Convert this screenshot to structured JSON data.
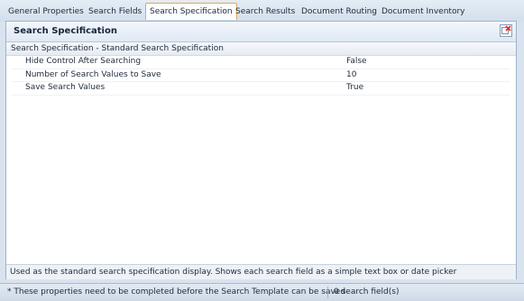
{
  "tabs": [
    {
      "label": "General Properties"
    },
    {
      "label": "Search Fields"
    },
    {
      "label": "Search Specification",
      "active": true
    },
    {
      "label": "Search Results"
    },
    {
      "label": "Document Routing"
    },
    {
      "label": "Document Inventory"
    }
  ],
  "panel": {
    "title": "Search Specification",
    "icon": "close-panel-icon",
    "section_header": "Search Specification - Standard Search Specification",
    "properties": [
      {
        "name": "Hide Control After Searching",
        "value": "False"
      },
      {
        "name": "Number of Search Values to Save",
        "value": "10"
      },
      {
        "name": "Save Search Values",
        "value": "True"
      }
    ],
    "description": "Used as the standard search specification display. Shows each search field as a simple text box or date picker"
  },
  "status": {
    "message": "* These properties need to be completed before the Search Template can be saved",
    "count": "0 search field(s)"
  },
  "colors": {
    "active_tab_border": "#e9a84a",
    "background": "#d9e3ef"
  }
}
